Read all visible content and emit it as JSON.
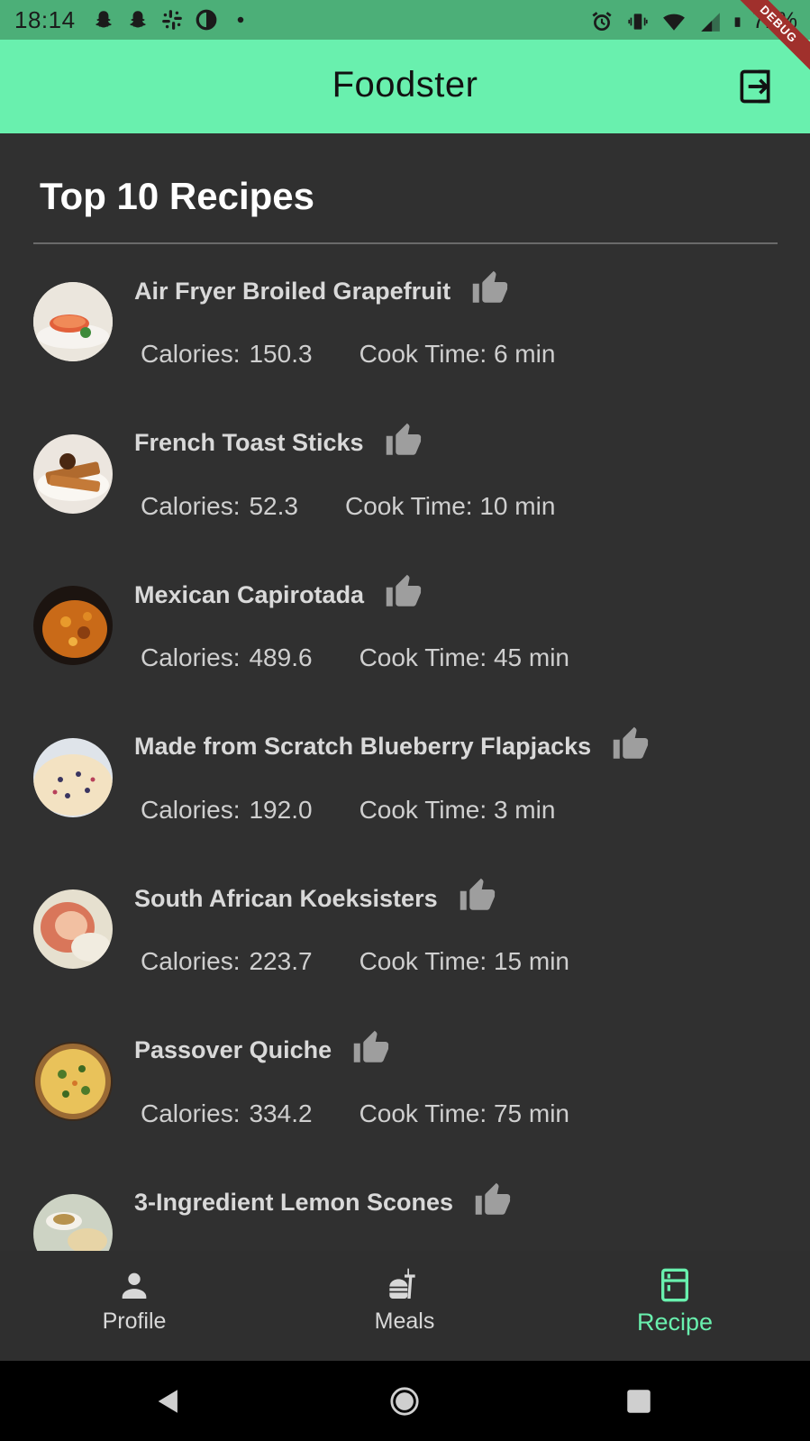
{
  "status_bar": {
    "time": "18:14",
    "battery": "71%",
    "left_icons": [
      "snapchat-icon",
      "snapchat-icon",
      "slack-icon",
      "data-saver-icon",
      "dot-icon"
    ],
    "right_icons": [
      "alarm-icon",
      "vibrate-icon",
      "wifi-icon",
      "signal-icon",
      "battery-icon"
    ]
  },
  "debug_banner": "DEBUG",
  "app_bar": {
    "title": "Foodster",
    "action_icon": "logout-icon"
  },
  "page": {
    "heading": "Top 10 Recipes"
  },
  "recipes": [
    {
      "name": "Air Fryer Broiled Grapefruit",
      "calories_label": "Calories:",
      "calories": "150.3",
      "cook_time": "Cook Time: 6 min"
    },
    {
      "name": "French Toast Sticks",
      "calories_label": "Calories:",
      "calories": "52.3",
      "cook_time": "Cook Time: 10 min"
    },
    {
      "name": "Mexican Capirotada",
      "calories_label": "Calories:",
      "calories": "489.6",
      "cook_time": "Cook Time: 45 min"
    },
    {
      "name": "Made from Scratch Blueberry Flapjacks",
      "calories_label": "Calories:",
      "calories": "192.0",
      "cook_time": "Cook Time: 3 min"
    },
    {
      "name": "South African Koeksisters",
      "calories_label": "Calories:",
      "calories": "223.7",
      "cook_time": "Cook Time: 15 min"
    },
    {
      "name": "Passover Quiche",
      "calories_label": "Calories:",
      "calories": "334.2",
      "cook_time": "Cook Time: 75 min"
    },
    {
      "name": "3-Ingredient Lemon Scones",
      "calories_label": "",
      "calories": "",
      "cook_time": ""
    }
  ],
  "bottom_nav": {
    "items": [
      {
        "label": "Profile",
        "icon": "person-icon",
        "active": false
      },
      {
        "label": "Meals",
        "icon": "fastfood-icon",
        "active": false
      },
      {
        "label": "Recipe",
        "icon": "kitchen-icon",
        "active": true
      }
    ]
  },
  "colors": {
    "accent": "#69f0ae",
    "status_bar": "#4caf78",
    "background": "#303030",
    "text_primary": "#ffffff",
    "text_secondary": "#cfcfcf"
  }
}
